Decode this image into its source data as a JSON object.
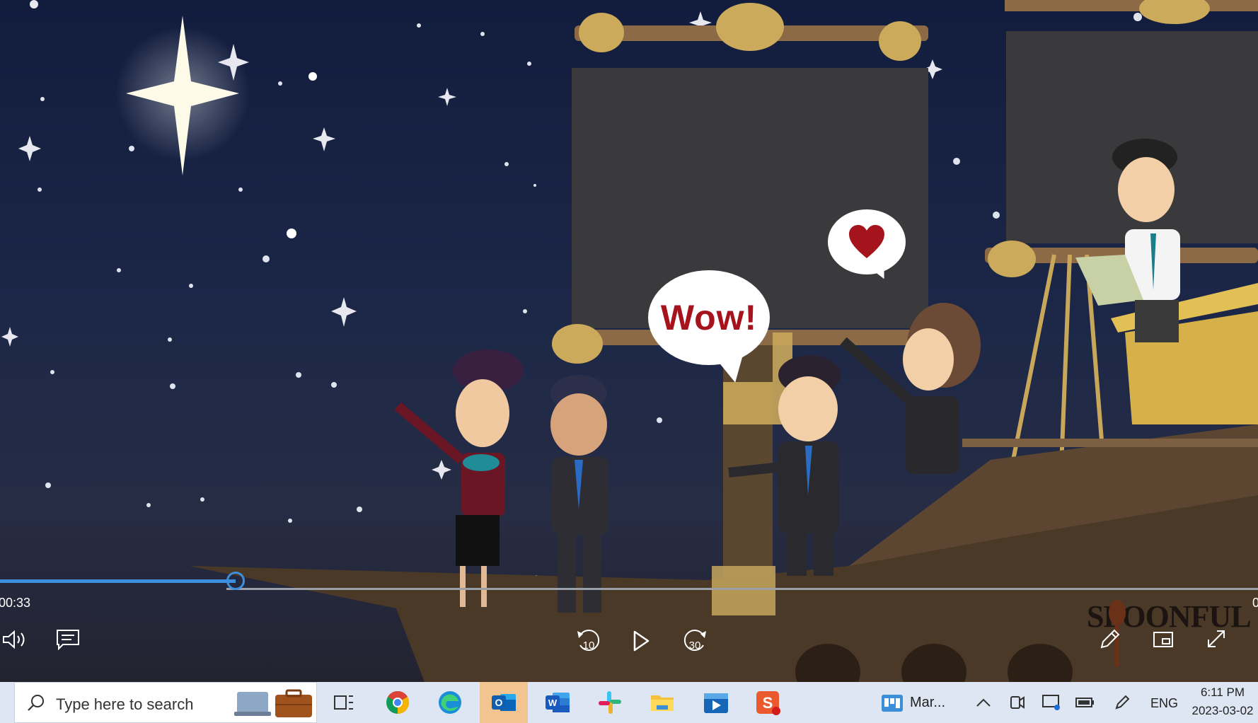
{
  "video": {
    "speech_bubble": "Wow!",
    "watermark": "SPOONFUL",
    "current_time": "00:33",
    "progress_percent": 18.7,
    "skip_back_label": "10",
    "skip_forward_label": "30"
  },
  "taskbar": {
    "search_placeholder": "Type here to search",
    "pinned_apps": [
      "task-view",
      "chrome",
      "edge",
      "outlook",
      "word",
      "slack",
      "file-explorer",
      "media-player",
      "screen-recorder"
    ],
    "active_app": "outlook",
    "widget_label": "Mar...",
    "language": "ENG",
    "time": "6:11 PM",
    "date": "2023-03-02"
  },
  "colors": {
    "accent": "#3c8fdd",
    "taskbar_bg": "#dde6f2",
    "active_app_bg": "#f2c48f",
    "bubble_text": "#a5131c"
  }
}
